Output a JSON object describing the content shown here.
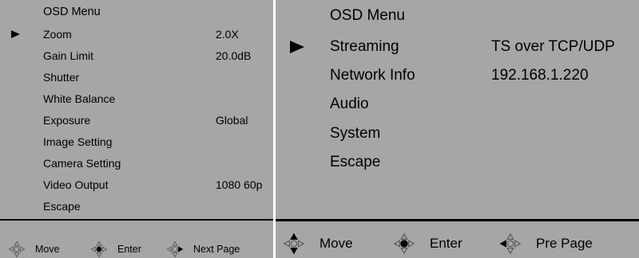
{
  "left": {
    "title": "OSD Menu",
    "selected_index": 0,
    "items": [
      {
        "label": "Zoom",
        "value": "2.0X"
      },
      {
        "label": "Gain Limit",
        "value": "20.0dB"
      },
      {
        "label": "Shutter",
        "value": ""
      },
      {
        "label": "White Balance",
        "value": ""
      },
      {
        "label": "Exposure",
        "value": "Global"
      },
      {
        "label": "Image Setting",
        "value": ""
      },
      {
        "label": "Camera Setting",
        "value": ""
      },
      {
        "label": "Video Output",
        "value": "1080 60p"
      },
      {
        "label": "Escape",
        "value": ""
      }
    ],
    "footer": [
      {
        "icon": "dpad-left-right-icon",
        "label": "Move"
      },
      {
        "icon": "dpad-center-icon",
        "label": "Enter"
      },
      {
        "icon": "dpad-right-icon",
        "label": "Next Page"
      }
    ]
  },
  "right": {
    "title": "OSD Menu",
    "selected_index": 0,
    "items": [
      {
        "label": "Streaming",
        "value": "TS over TCP/UDP"
      },
      {
        "label": "Network Info",
        "value": "192.168.1.220"
      },
      {
        "label": "Audio",
        "value": ""
      },
      {
        "label": "System",
        "value": ""
      },
      {
        "label": "Escape",
        "value": ""
      }
    ],
    "footer": [
      {
        "icon": "dpad-left-right-icon",
        "label": "Move"
      },
      {
        "icon": "dpad-center-icon",
        "label": "Enter"
      },
      {
        "icon": "dpad-left-icon",
        "label": "Pre Page"
      }
    ]
  },
  "colors": {
    "panel_bg": "#a6a6a6",
    "pad_outline": "#5a5a5a",
    "text": "#000000"
  }
}
